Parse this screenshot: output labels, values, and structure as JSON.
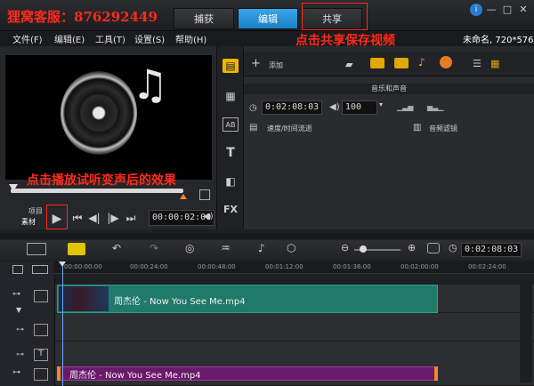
{
  "header": {
    "brand": "狸窝客服：876292449",
    "tabs": [
      {
        "label": "捕获"
      },
      {
        "label": "编辑",
        "active": true
      },
      {
        "label": "共享"
      }
    ],
    "project_info": "未命名, 720*576"
  },
  "menu": {
    "items": [
      "文件(F)",
      "编辑(E)",
      "工具(T)",
      "设置(S)",
      "帮助(H)"
    ]
  },
  "annotations": {
    "share_hint": "点击共享保存视频",
    "play_hint": "点击播放试听变声后的效果"
  },
  "player": {
    "mode_project": "项目",
    "mode_clip": "素材",
    "timecode": "00:00:02:00"
  },
  "library": {
    "add_label": "添加",
    "section_title": "音乐和声音",
    "duration": "0:02:08:03",
    "volume": "100",
    "speed_label": "速度/时间流逝",
    "filter_label": "音频滤镜"
  },
  "timeline": {
    "timecode": "0:02:08:03",
    "ruler_labels": [
      "00:00:00:00",
      "00:00:24:00",
      "00:00:48:00",
      "00:01:12:00",
      "00:01:36:00",
      "00:02:00:00",
      "00:02:24:00"
    ],
    "video_clip": "周杰伦 - Now You See Me.mp4",
    "audio_clip": "周杰伦 - Now You See Me.mp4"
  }
}
